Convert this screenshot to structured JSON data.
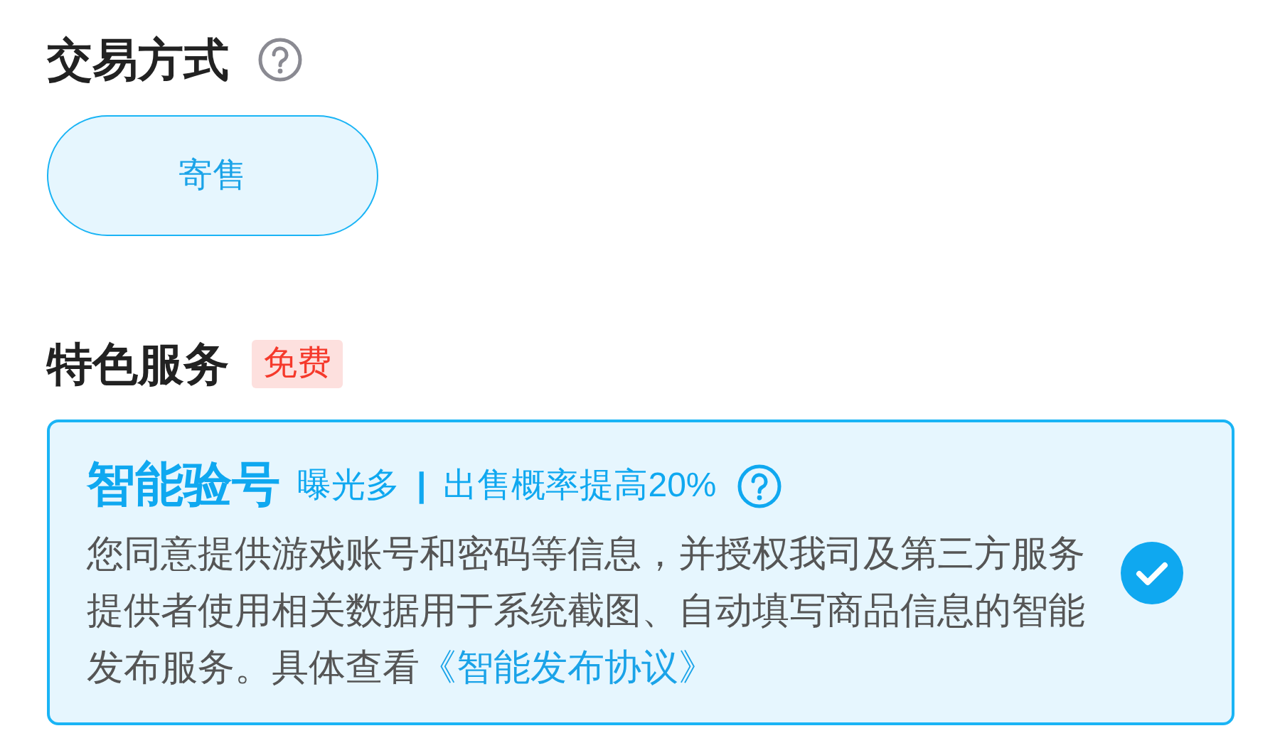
{
  "trade_section": {
    "title": "交易方式",
    "options": [
      {
        "label": "寄售",
        "selected": true
      }
    ]
  },
  "service_section": {
    "title": "特色服务",
    "badge": "免费",
    "service": {
      "name": "智能验号",
      "tags": [
        "曝光多",
        "出售概率提高20%"
      ],
      "separator": "|",
      "description": "您同意提供游戏账号和密码等信息，并授权我司及第三方服务提供者使用相关数据用于系统截图、自动填写商品信息的智能发布服务。具体查看",
      "link": "《智能发布协议》",
      "checked": true
    }
  }
}
